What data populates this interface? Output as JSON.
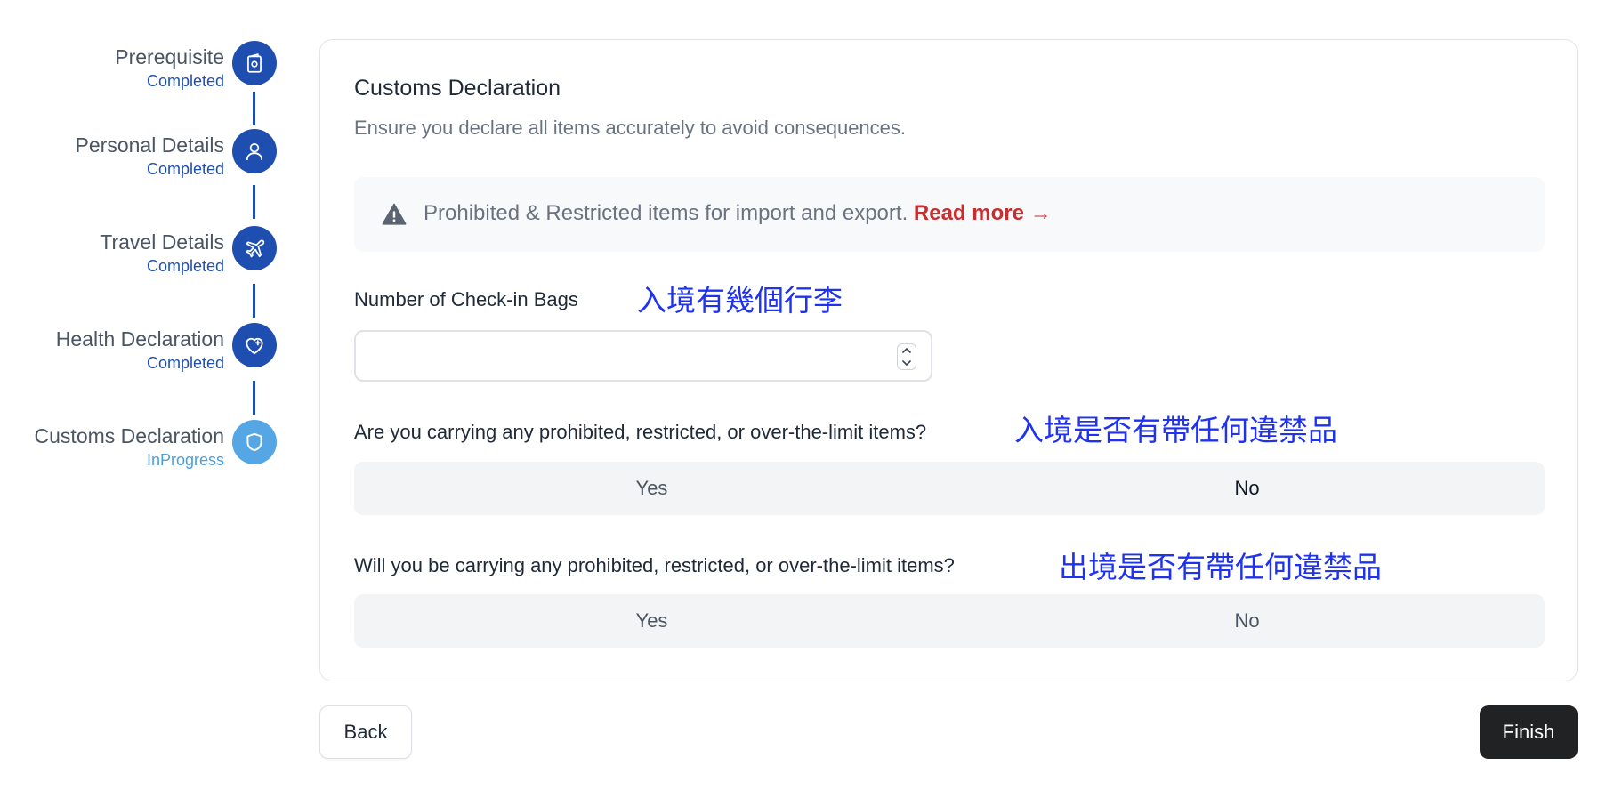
{
  "stepper": {
    "steps": [
      {
        "title": "Prerequisite",
        "status": "Completed",
        "icon": "passport-icon"
      },
      {
        "title": "Personal Details",
        "status": "Completed",
        "icon": "user-icon"
      },
      {
        "title": "Travel Details",
        "status": "Completed",
        "icon": "airplane-icon"
      },
      {
        "title": "Health Declaration",
        "status": "Completed",
        "icon": "heart-plus-icon"
      },
      {
        "title": "Customs Declaration",
        "status": "InProgress",
        "icon": "shield-icon"
      }
    ],
    "colors": {
      "completed": "#1e4eb0",
      "in_progress": "#54a7e4"
    }
  },
  "form": {
    "title": "Customs Declaration",
    "description": "Ensure you declare all items accurately to avoid consequences.",
    "alert": {
      "icon": "warning-icon",
      "text": "Prohibited & Restricted items for import and export.",
      "link": "Read more →",
      "link_color": "#c62f2f"
    },
    "bags": {
      "label": "Number of Check-in Bags",
      "note": "入境有幾個行李",
      "value": ""
    },
    "q1": {
      "label": "Are you carrying any prohibited, restricted, or over-the-limit items?",
      "note": "入境是否有帶任何違禁品",
      "yes": "Yes",
      "no": "No"
    },
    "q2": {
      "label": "Will you be carrying any prohibited, restricted, or over-the-limit items?",
      "note": "出境是否有帶任何違禁品",
      "yes": "Yes",
      "no": "No"
    }
  },
  "footer": {
    "back_label": "Back",
    "finish_label": "Finish"
  },
  "annotation_color": "#1f32f0"
}
